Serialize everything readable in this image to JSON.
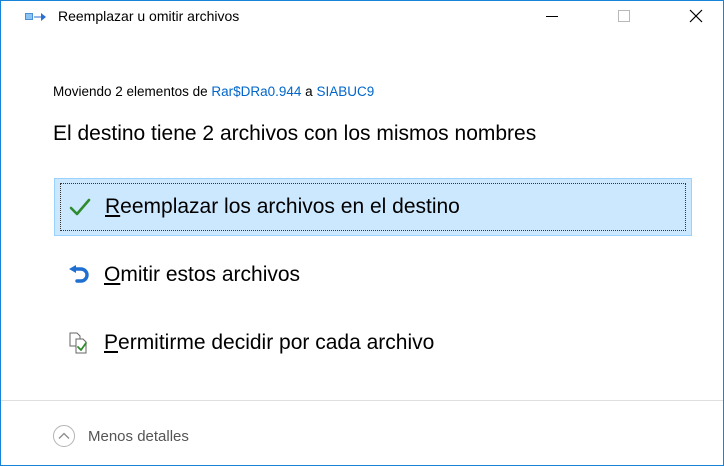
{
  "window": {
    "title": "Reemplazar u omitir archivos",
    "controls": {
      "minimize": "minimize",
      "maximize": "maximize",
      "close": "close"
    }
  },
  "subtitle": {
    "prefix": "Moviendo 2 elementos de ",
    "source": "Rar$DRa0.944",
    "middle": " a ",
    "destination": "SIABUC9"
  },
  "heading": "El destino tiene 2 archivos con los mismos nombres",
  "options": [
    {
      "first": "R",
      "rest": "eemplazar los archivos en el destino",
      "icon": "checkmark-icon",
      "selected": true
    },
    {
      "first": "O",
      "rest": "mitir estos archivos",
      "icon": "skip-arrow-icon",
      "selected": false
    },
    {
      "first": "P",
      "rest": "ermitirme decidir por cada archivo",
      "icon": "compare-files-icon",
      "selected": false
    }
  ],
  "footer": {
    "details_label": "Menos detalles"
  },
  "colors": {
    "accent": "#1883d7",
    "link": "#0066cc",
    "selected_bg": "#cce8ff",
    "selected_border": "#99d1ff",
    "check": "#2e8b2e",
    "skip": "#1e6fd0"
  }
}
